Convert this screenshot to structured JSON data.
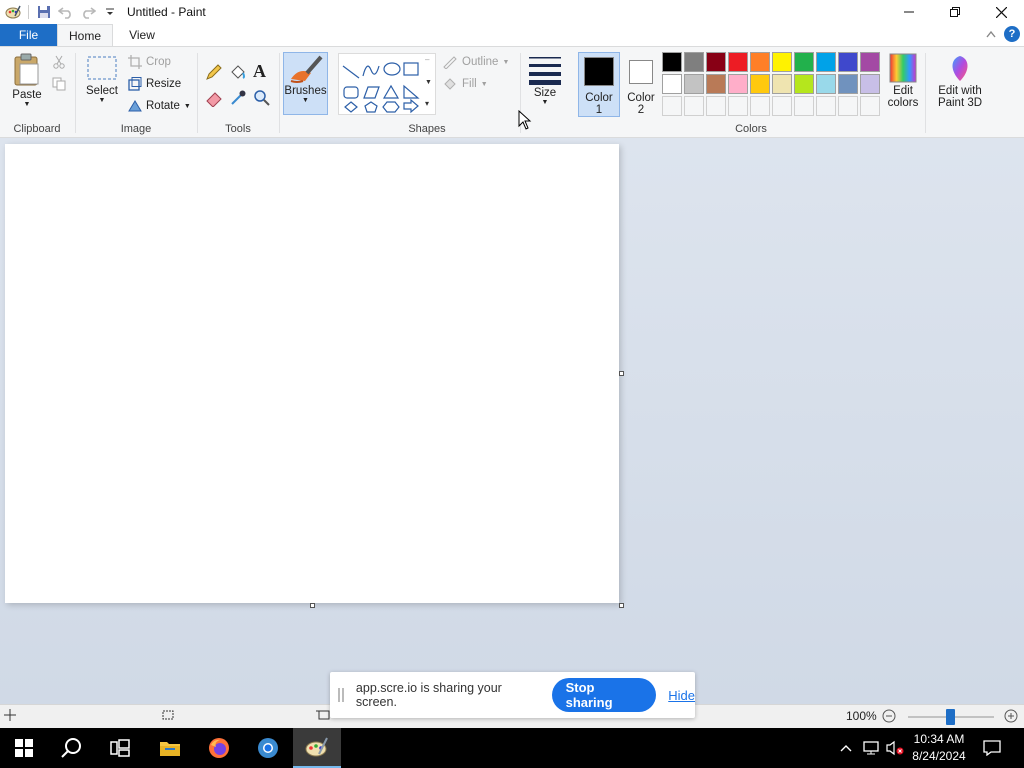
{
  "window": {
    "title": "Untitled - Paint",
    "icons": [
      "paint-app-icon",
      "save-icon",
      "undo-icon",
      "redo-icon",
      "customize-quick-access-icon"
    ]
  },
  "tabs": {
    "file": "File",
    "home": "Home",
    "view": "View",
    "help": "?"
  },
  "ribbon": {
    "clipboard": {
      "paste": "Paste",
      "group": "Clipboard"
    },
    "image": {
      "select": "Select",
      "crop": "Crop",
      "resize": "Resize",
      "rotate": "Rotate",
      "group": "Image"
    },
    "tools": {
      "group": "Tools"
    },
    "brushes": {
      "label": "Brushes"
    },
    "shapes": {
      "outline": "Outline",
      "fill": "Fill",
      "group": "Shapes"
    },
    "size": {
      "label": "Size"
    },
    "colors": {
      "color1_line1": "Color",
      "color1_line2": "1",
      "color2_line1": "Color",
      "color2_line2": "2",
      "edit_colors_line1": "Edit",
      "edit_colors_line2": "colors",
      "paint3d_line1": "Edit with",
      "paint3d_line2": "Paint 3D",
      "group": "Colors",
      "color1_value": "#000000",
      "color2_value": "#ffffff",
      "palette_row1": [
        "#000000",
        "#7f7f7f",
        "#880015",
        "#ed1c24",
        "#ff7f27",
        "#fff200",
        "#22b14c",
        "#00a2e8",
        "#3f48cc",
        "#a349a4"
      ],
      "palette_row2": [
        "#ffffff",
        "#c3c3c3",
        "#b97a57",
        "#ffaec9",
        "#ffc90e",
        "#efe4b0",
        "#b5e61d",
        "#99d9ea",
        "#7092be",
        "#c8bfe7"
      ]
    }
  },
  "sharing": {
    "message": "app.scre.io is sharing your screen.",
    "stop": "Stop sharing",
    "hide": "Hide"
  },
  "statusbar": {
    "zoom": "100%"
  },
  "taskbar": {
    "time": "10:34 AM",
    "date": "8/24/2024"
  }
}
